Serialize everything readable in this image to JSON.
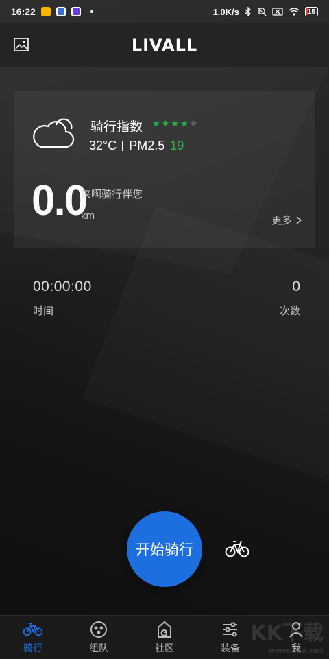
{
  "status_bar": {
    "time": "16:22",
    "network_speed": "1.0K/s",
    "battery": "15"
  },
  "header": {
    "brand": "LIVALL",
    "left_icon": "image-icon"
  },
  "weather": {
    "ride_index_label": "骑行指数",
    "rating": 4,
    "rating_max": 5,
    "temperature": "32°C",
    "pm_label": "PM2.5",
    "pm_value": "19",
    "icon": "cloud-icon"
  },
  "ride": {
    "distance": "0.0",
    "slogan": "来啊骑行伴您",
    "unit": "km",
    "more_label": "更多"
  },
  "stats": {
    "time_value": "00:00:00",
    "time_label": "时间",
    "count_value": "0",
    "count_label": "次数"
  },
  "actions": {
    "start_label": "开始骑行",
    "bike_icon": "bicycle-icon"
  },
  "bottom_nav": {
    "items": [
      {
        "label": "骑行",
        "icon": "bicycle-icon",
        "active": true
      },
      {
        "label": "组队",
        "icon": "team-icon",
        "active": false
      },
      {
        "label": "社区",
        "icon": "community-icon",
        "active": false
      },
      {
        "label": "装备",
        "icon": "sliders-icon",
        "active": false
      },
      {
        "label": "我",
        "icon": "person-icon",
        "active": false
      }
    ]
  },
  "watermark": {
    "text": "KK下载",
    "sub": "www.kkx.net"
  },
  "colors": {
    "accent": "#1d6fe0",
    "star_green": "#24b34b",
    "background": "#1c1c1c"
  }
}
